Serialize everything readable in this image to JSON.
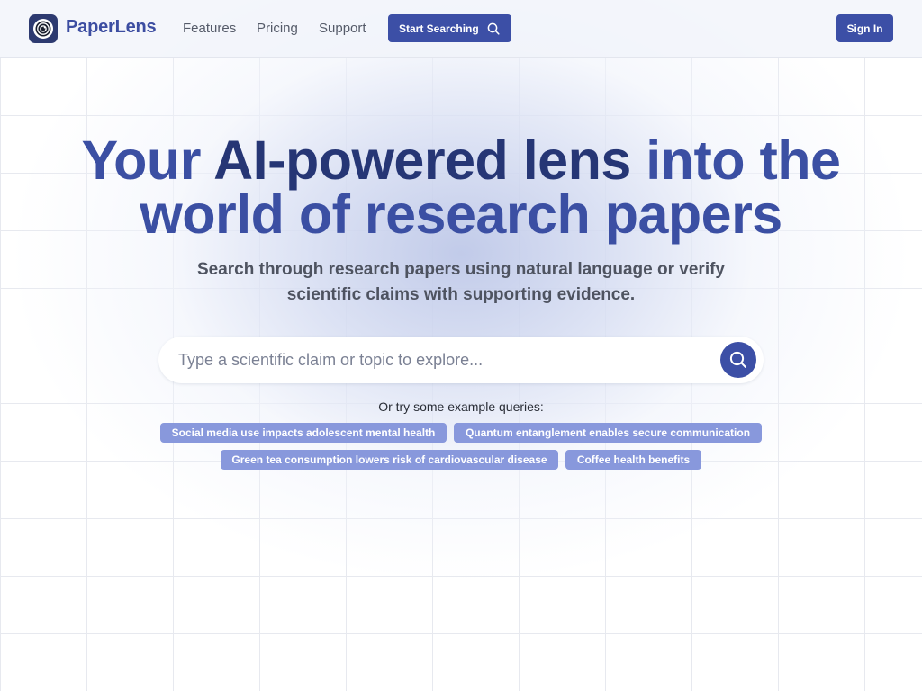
{
  "header": {
    "brand": "PaperLens",
    "nav": [
      "Features",
      "Pricing",
      "Support"
    ],
    "cta_label": "Start Searching",
    "signin_label": "Sign In"
  },
  "hero": {
    "title_part1": "Your ",
    "title_part2": "AI-powered lens",
    "title_part3": " into the",
    "title_line2": "world of research papers",
    "subtitle": "Search through research papers using natural language or verify scientific claims with supporting evidence."
  },
  "search": {
    "placeholder": "Type a scientific claim or topic to explore...",
    "value": ""
  },
  "examples": {
    "label": "Or try some example queries:",
    "queries": [
      "Social media use impacts adolescent mental health",
      "Quantum entanglement enables secure communication",
      "Green tea consumption lowers risk of cardiovascular disease",
      "Coffee health benefits"
    ]
  },
  "colors": {
    "accent": "#3c4fa6",
    "chip": "#8898dc",
    "title_dark": "#263675",
    "title_light": "#3b4fa3"
  },
  "icons": {
    "logo": "lens-icon",
    "cta": "search-icon",
    "search_button": "search-icon"
  }
}
